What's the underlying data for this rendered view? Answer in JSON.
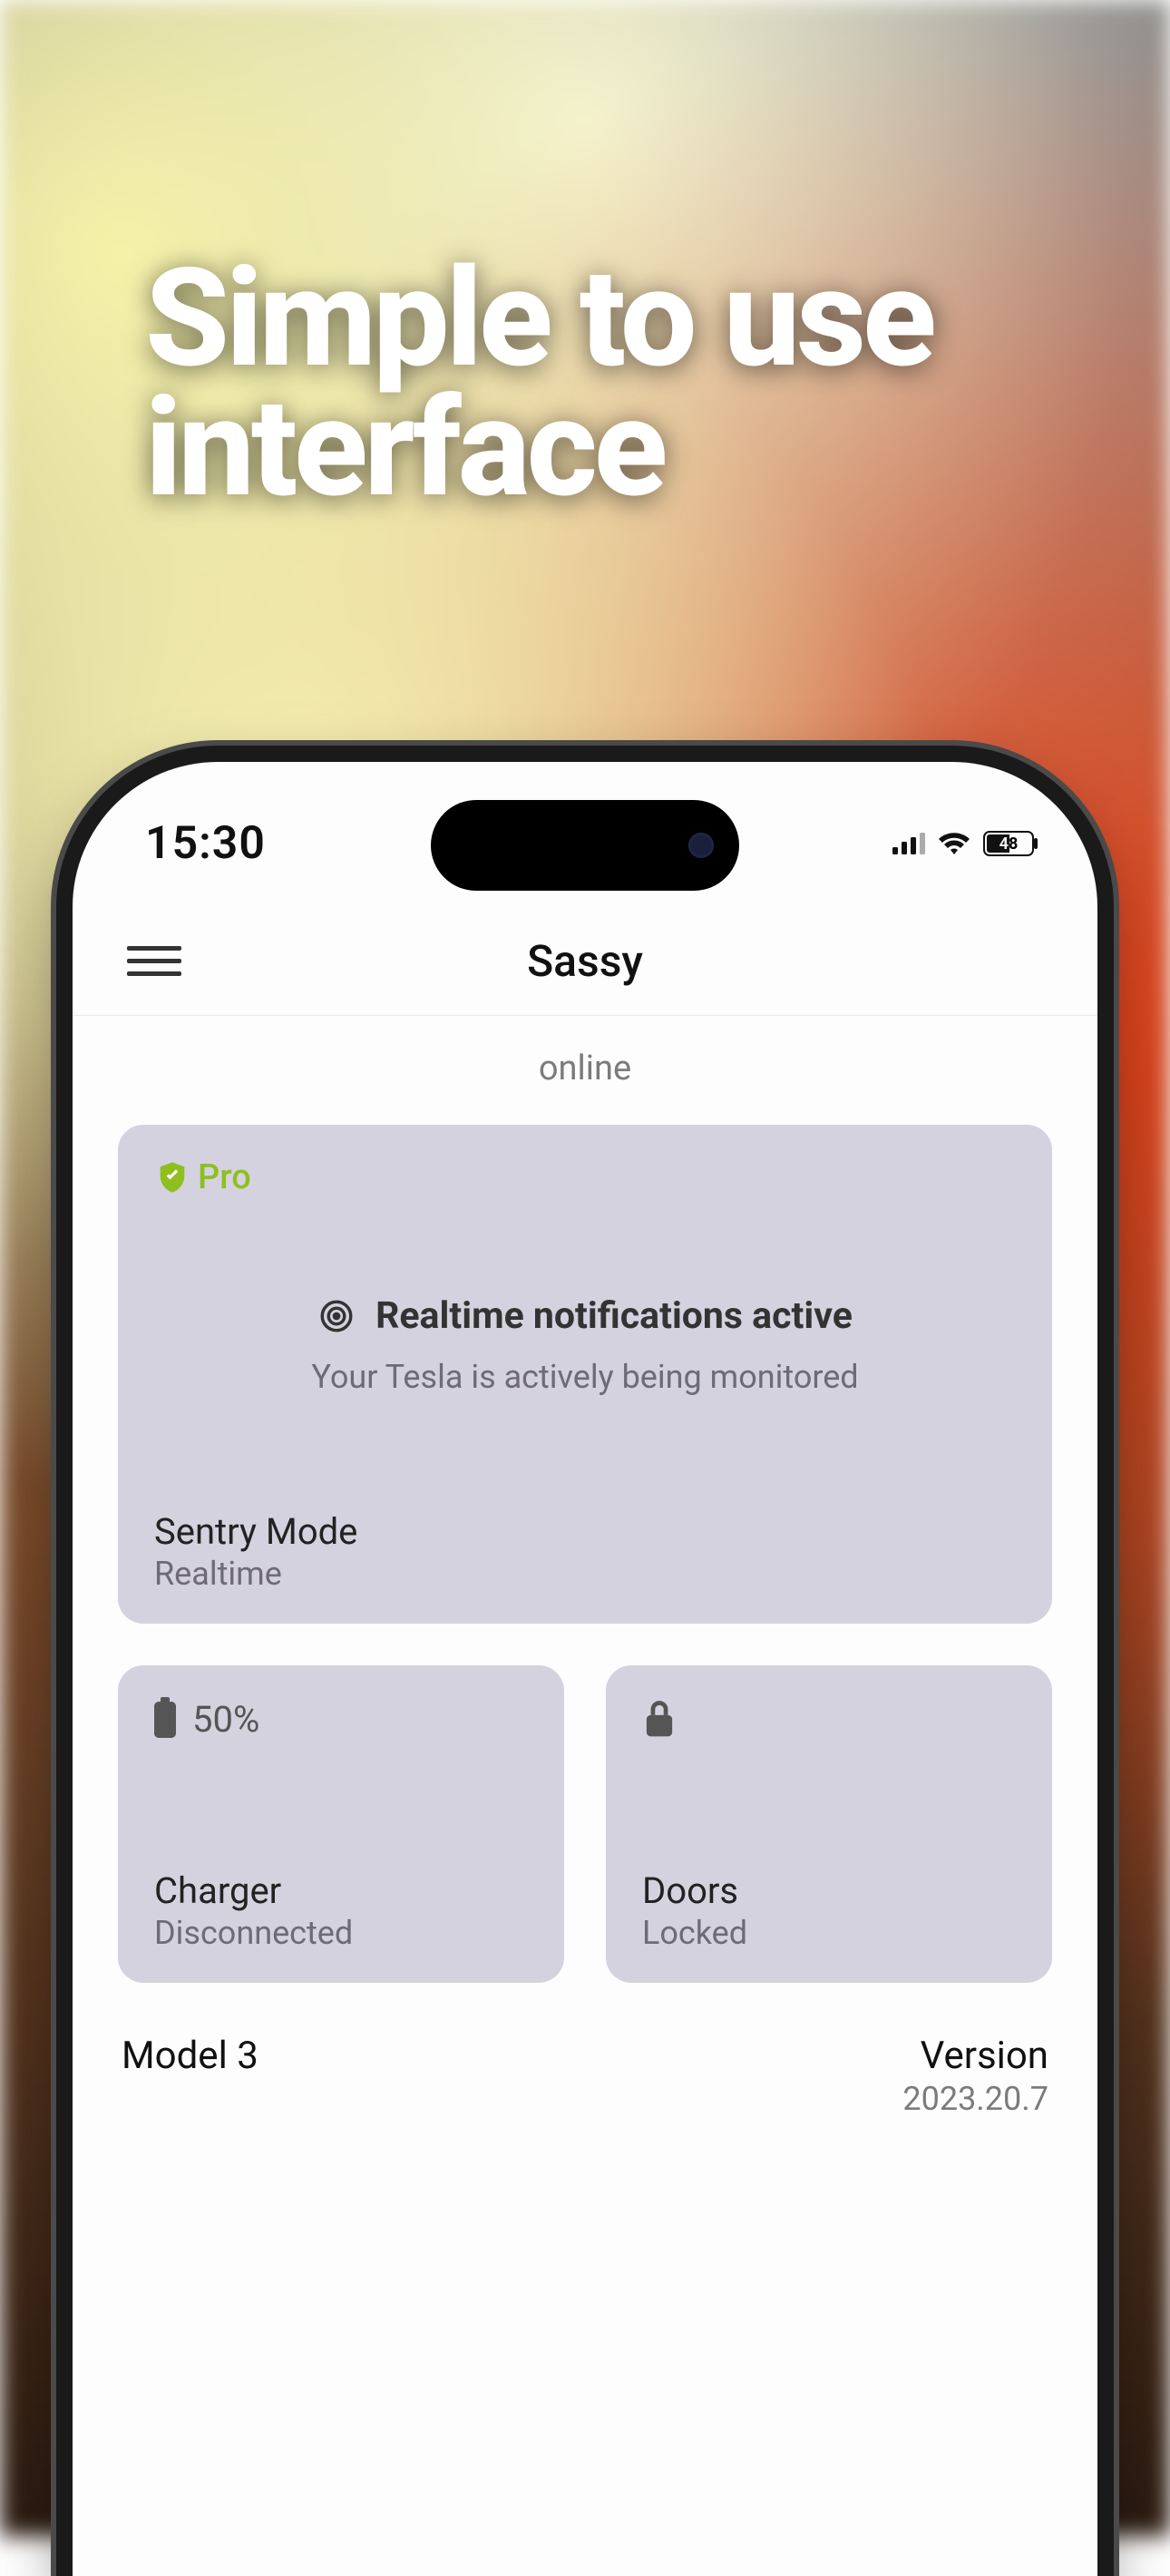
{
  "marketing": {
    "headline": "Simple to use interface"
  },
  "status_bar": {
    "time": "15:30",
    "battery_text": "48"
  },
  "appbar": {
    "title": "Sassy"
  },
  "status": {
    "text": "online"
  },
  "sentry_card": {
    "pro_label": "Pro",
    "title": "Realtime notifications active",
    "subtitle": "Your Tesla is actively being monitored",
    "footer_label": "Sentry Mode",
    "footer_sub": "Realtime"
  },
  "charger_card": {
    "percent": "50%",
    "label": "Charger",
    "sub": "Disconnected"
  },
  "doors_card": {
    "label": "Doors",
    "sub": "Locked"
  },
  "footer": {
    "model": "Model 3",
    "version_label": "Version",
    "version_value": "2023.20.7"
  }
}
